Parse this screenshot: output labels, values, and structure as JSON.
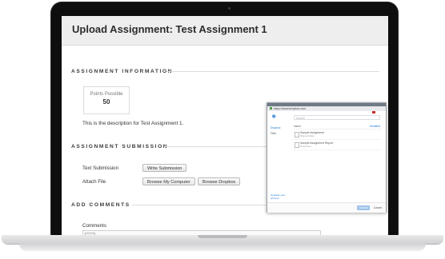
{
  "page": {
    "title": "Upload Assignment: Test Assignment 1"
  },
  "assignment_information": {
    "heading": "ASSIGNMENT INFORMATION",
    "points_label": "Points Possible",
    "points_value": "50",
    "description": "This is the description for Test Assignment 1."
  },
  "assignment_submission": {
    "heading": "ASSIGNMENT SUBMISSION",
    "text_submission_label": "Text Submission",
    "write_submission_button": "Write Submission",
    "attach_file_label": "Attach File",
    "browse_computer_button": "Browse My Computer",
    "browse_dropbox_button": "Browse Dropbox"
  },
  "add_comments": {
    "heading": "ADD COMMENTS",
    "comments_label": "Comments"
  },
  "dropbox_popup": {
    "window_title": "Dropbox",
    "address": "https://www.dropbox.com",
    "search_placeholder": "Search",
    "sidebar": [
      "Dropbox",
      "Files"
    ],
    "sidebar_footer": "Upgrade your account",
    "column_name": "Name",
    "sort_label": "Modified",
    "files": [
      {
        "name": "Sample Assignment",
        "meta": "Shared folder"
      },
      {
        "name": "Sample Assignment Report",
        "meta": "Document"
      }
    ],
    "choose_button": "Choose",
    "cancel_button": "Cancel"
  },
  "icons": {
    "camera": "camera-icon",
    "dropbox_logo": "dropbox-logo-icon",
    "lock": "lock-icon",
    "file": "file-icon"
  },
  "colors": {
    "accent": "#1e7bd6",
    "laptop_bezel": "#0e0e0e",
    "title_bar": "#eeeeee"
  }
}
